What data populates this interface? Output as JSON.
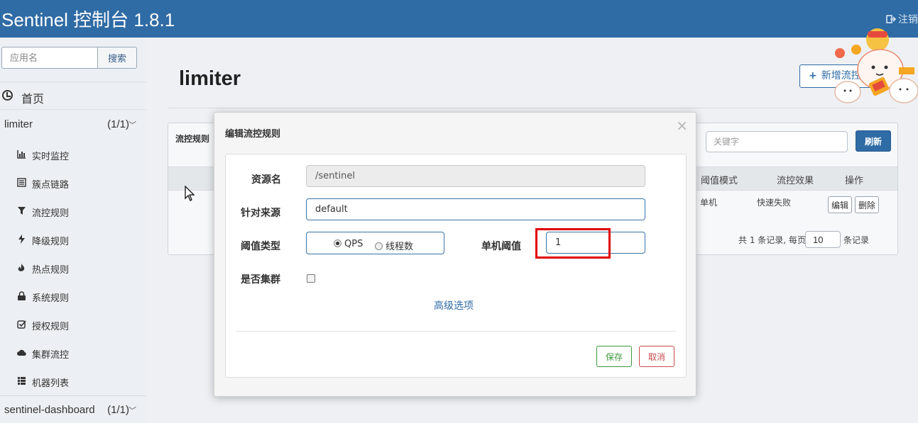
{
  "header": {
    "brand": "Sentinel 控制台 1.8.1",
    "logout_label": "注销"
  },
  "sidebar": {
    "search_placeholder": "应用名",
    "search_button": "搜索",
    "home_label": "首页",
    "apps": [
      {
        "name": "limiter",
        "count": "(1/1)",
        "items": [
          {
            "icon": "bar-chart-icon",
            "label": "实时监控"
          },
          {
            "icon": "list-icon",
            "label": "簇点链路"
          },
          {
            "icon": "filter-icon",
            "label": "流控规则"
          },
          {
            "icon": "flash-icon",
            "label": "降级规则"
          },
          {
            "icon": "fire-icon",
            "label": "热点规则"
          },
          {
            "icon": "lock-icon",
            "label": "系统规则"
          },
          {
            "icon": "check-square-icon",
            "label": "授权规则"
          },
          {
            "icon": "cloud-icon",
            "label": "集群流控"
          },
          {
            "icon": "grid-list-icon",
            "label": "机器列表"
          }
        ]
      },
      {
        "name": "sentinel-dashboard",
        "count": "(1/1)"
      }
    ]
  },
  "main": {
    "title": "limiter",
    "new_rule_button": "新增流控规",
    "panel_title": "流控规则",
    "keyword_placeholder": "关键字",
    "refresh_button": "刷新",
    "columns": [
      "阈值模式",
      "流控效果",
      "操作"
    ],
    "row": {
      "mode": "单机",
      "effect": "快速失败",
      "edit": "编辑",
      "delete": "删除"
    },
    "pager": {
      "prefix": "共 1 条记录, 每页",
      "page_size": "10",
      "suffix": "条记录"
    }
  },
  "modal": {
    "title": "编辑流控规则",
    "close": "×",
    "fields": {
      "resource_label": "资源名",
      "resource_value": "/sentinel",
      "origin_label": "针对来源",
      "origin_value": "default",
      "threshold_type_label": "阈值类型",
      "threshold_options": [
        "QPS",
        "线程数"
      ],
      "threshold_selected": "QPS",
      "single_threshold_label": "单机阈值",
      "single_threshold_value": "1",
      "cluster_label": "是否集群",
      "cluster_checked": false
    },
    "advanced_link": "高级选项",
    "save_button": "保存",
    "cancel_button": "取消"
  },
  "colors": {
    "header_bg": "#2f6ba5",
    "highlight": "#e00000",
    "save": "#3c9a3c",
    "cancel": "#c84a4a"
  }
}
